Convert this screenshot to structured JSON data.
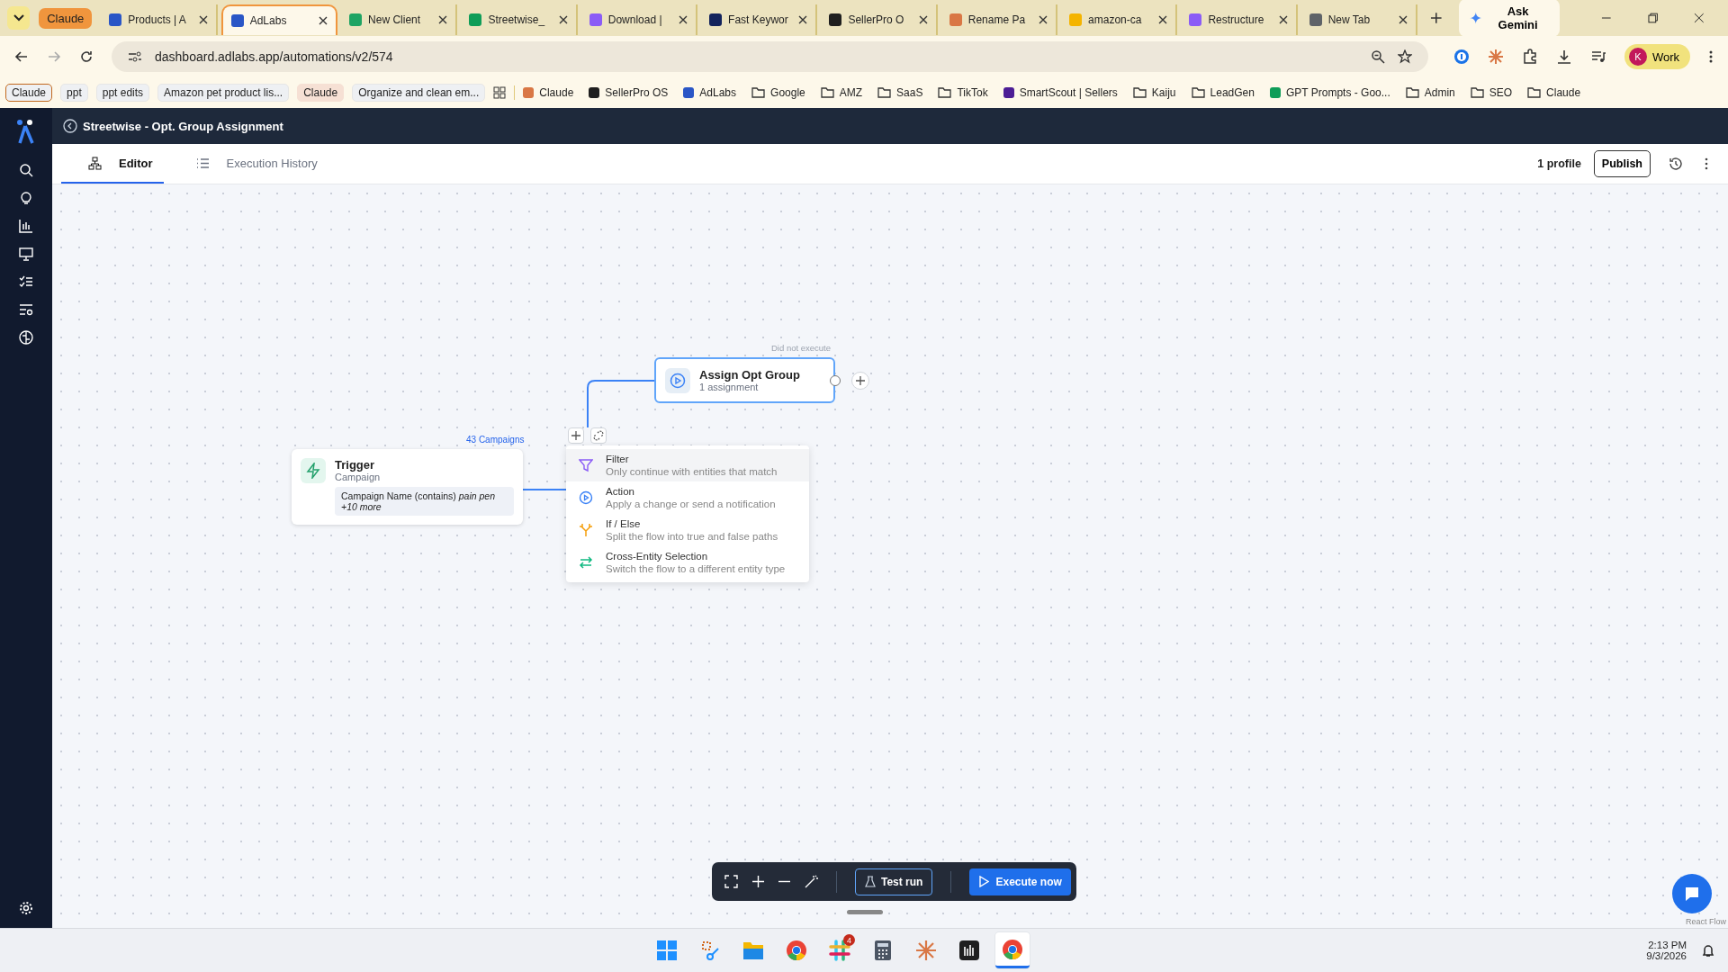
{
  "browser": {
    "tab_group": {
      "label": "Claude",
      "color": "#f0953d"
    },
    "tabs": [
      {
        "label": "Products | A",
        "selected": false,
        "color": "#2a56c6"
      },
      {
        "label": "AdLabs",
        "selected": true,
        "color": "#2a56c6"
      },
      {
        "label": "New Client",
        "selected": false,
        "color": "#1fa463"
      },
      {
        "label": "Streetwise_",
        "selected": false,
        "color": "#0f9d58"
      },
      {
        "label": "Download |",
        "selected": false,
        "color": "#8b5cf6"
      },
      {
        "label": "Fast Keywor",
        "selected": false,
        "color": "#13235c"
      },
      {
        "label": "SellerPro O",
        "selected": false,
        "color": "#1f1f1f"
      },
      {
        "label": "Rename Pa",
        "selected": false,
        "color": "#d97745"
      },
      {
        "label": "amazon-ca",
        "selected": false,
        "color": "#f4b400"
      },
      {
        "label": "Restructure",
        "selected": false,
        "color": "#8b5cf6"
      },
      {
        "label": "New Tab",
        "selected": false,
        "color": "#5f6368"
      }
    ],
    "gemini": "Ask Gemini",
    "url": "dashboard.adlabs.app/automations/v2/574",
    "profile": {
      "initial": "K",
      "label": "Work"
    },
    "chips": [
      {
        "label": "Claude",
        "color": "#c2691f"
      },
      {
        "label": "ppt",
        "color": "#e6e6e6"
      },
      {
        "label": "ppt edits",
        "color": "#e6e6e6"
      },
      {
        "label": "Amazon pet product lis...",
        "color": "#e6e6e6"
      },
      {
        "label": "Claude",
        "color": "#f6e0d4"
      },
      {
        "label": "Organize and clean em...",
        "color": "#e6e6e6"
      }
    ],
    "bookmarks": [
      {
        "kind": "site",
        "label": "Claude",
        "color": "#d97745"
      },
      {
        "kind": "site",
        "label": "SellerPro OS",
        "color": "#1f1f1f"
      },
      {
        "kind": "site",
        "label": "AdLabs",
        "color": "#2a56c6"
      },
      {
        "kind": "folder",
        "label": "Google"
      },
      {
        "kind": "folder",
        "label": "AMZ"
      },
      {
        "kind": "folder",
        "label": "SaaS"
      },
      {
        "kind": "folder",
        "label": "TikTok"
      },
      {
        "kind": "site",
        "label": "SmartScout | Sellers",
        "color": "#4c1d95"
      },
      {
        "kind": "folder",
        "label": "Kaiju"
      },
      {
        "kind": "folder",
        "label": "LeadGen"
      },
      {
        "kind": "site",
        "label": "GPT Prompts - Goo...",
        "color": "#0f9d58"
      },
      {
        "kind": "folder",
        "label": "Admin"
      },
      {
        "kind": "folder",
        "label": "SEO"
      },
      {
        "kind": "folder",
        "label": "Claude"
      }
    ]
  },
  "app": {
    "title": "Streetwise - Opt. Group Assignment",
    "tabs": [
      {
        "label": "Editor",
        "selected": true
      },
      {
        "label": "Execution History",
        "selected": false
      }
    ],
    "profiles": "1 profile",
    "publish": "Publish",
    "trigger": {
      "count": "43 Campaigns",
      "title": "Trigger",
      "subtitle": "Campaign",
      "condition": "Campaign Name (contains) *pain pen*",
      "more": "+10 more"
    },
    "action_node": {
      "status": "Did not execute",
      "title": "Assign Opt Group",
      "subtitle": "1 assignment"
    },
    "menu": [
      {
        "kind": "filter",
        "title": "Filter",
        "description": "Only continue with entities that match",
        "selected": true
      },
      {
        "kind": "action",
        "title": "Action",
        "description": "Apply a change or send a notification",
        "selected": false
      },
      {
        "kind": "ifelse",
        "title": "If / Else",
        "description": "Split the flow into true and false paths",
        "selected": false
      },
      {
        "kind": "cross",
        "title": "Cross-Entity Selection",
        "description": "Switch the flow to a different entity type",
        "selected": false
      }
    ],
    "test_run": "Test run",
    "execute": "Execute now",
    "attribution": "React Flow"
  },
  "taskbar": {
    "apps": [
      {
        "kind": "start",
        "active": false
      },
      {
        "kind": "snip",
        "active": false
      },
      {
        "kind": "files",
        "active": false
      },
      {
        "kind": "chrome",
        "active": false
      },
      {
        "kind": "slack",
        "active": false,
        "badge": "4"
      },
      {
        "kind": "calc",
        "active": false
      },
      {
        "kind": "claude",
        "active": false
      },
      {
        "kind": "meter",
        "active": false
      },
      {
        "kind": "chrome",
        "active": true
      }
    ],
    "time": "2:13 PM",
    "date": "9/3/2026"
  }
}
